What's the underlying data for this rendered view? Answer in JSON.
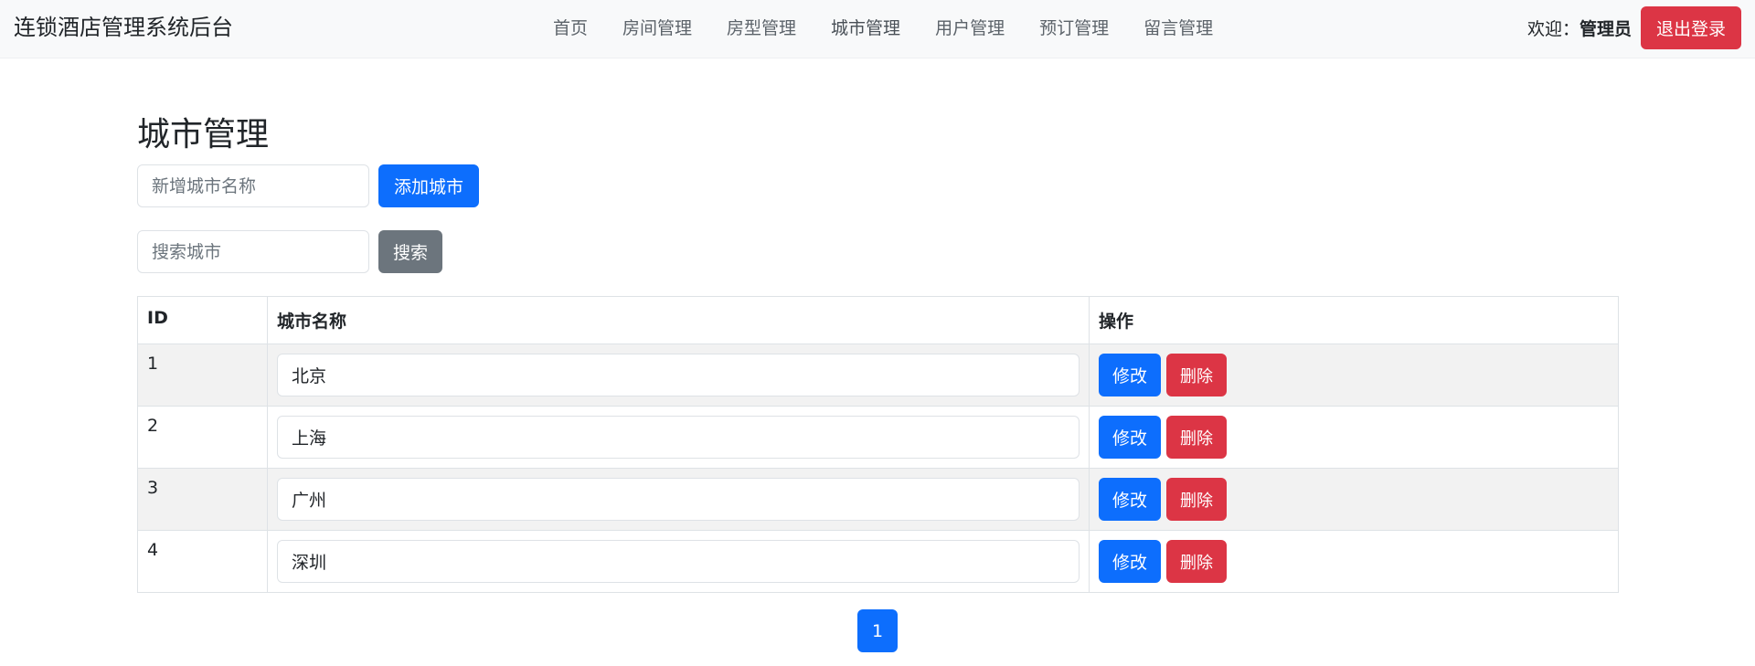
{
  "app": {
    "title": "连锁酒店管理系统后台"
  },
  "nav": {
    "items": [
      {
        "label": "首页"
      },
      {
        "label": "房间管理"
      },
      {
        "label": "房型管理"
      },
      {
        "label": "城市管理"
      },
      {
        "label": "用户管理"
      },
      {
        "label": "预订管理"
      },
      {
        "label": "留言管理"
      }
    ],
    "welcome_prefix": "欢迎：",
    "username": "管理员",
    "logout_label": "退出登录"
  },
  "page": {
    "title": "城市管理"
  },
  "add_form": {
    "placeholder": "新增城市名称",
    "button_label": "添加城市"
  },
  "search_form": {
    "placeholder": "搜索城市",
    "button_label": "搜索"
  },
  "table": {
    "headers": [
      "ID",
      "城市名称",
      "操作"
    ],
    "rows": [
      {
        "id": "1",
        "name": "北京"
      },
      {
        "id": "2",
        "name": "上海"
      },
      {
        "id": "3",
        "name": "广州"
      },
      {
        "id": "4",
        "name": "深圳"
      }
    ],
    "edit_label": "修改",
    "delete_label": "删除"
  },
  "pagination": {
    "current_page": "1"
  },
  "colors": {
    "primary": "#0d6efd",
    "danger": "#dc3545",
    "secondary": "#6c757d",
    "navbar_bg": "#f8f9fa"
  }
}
